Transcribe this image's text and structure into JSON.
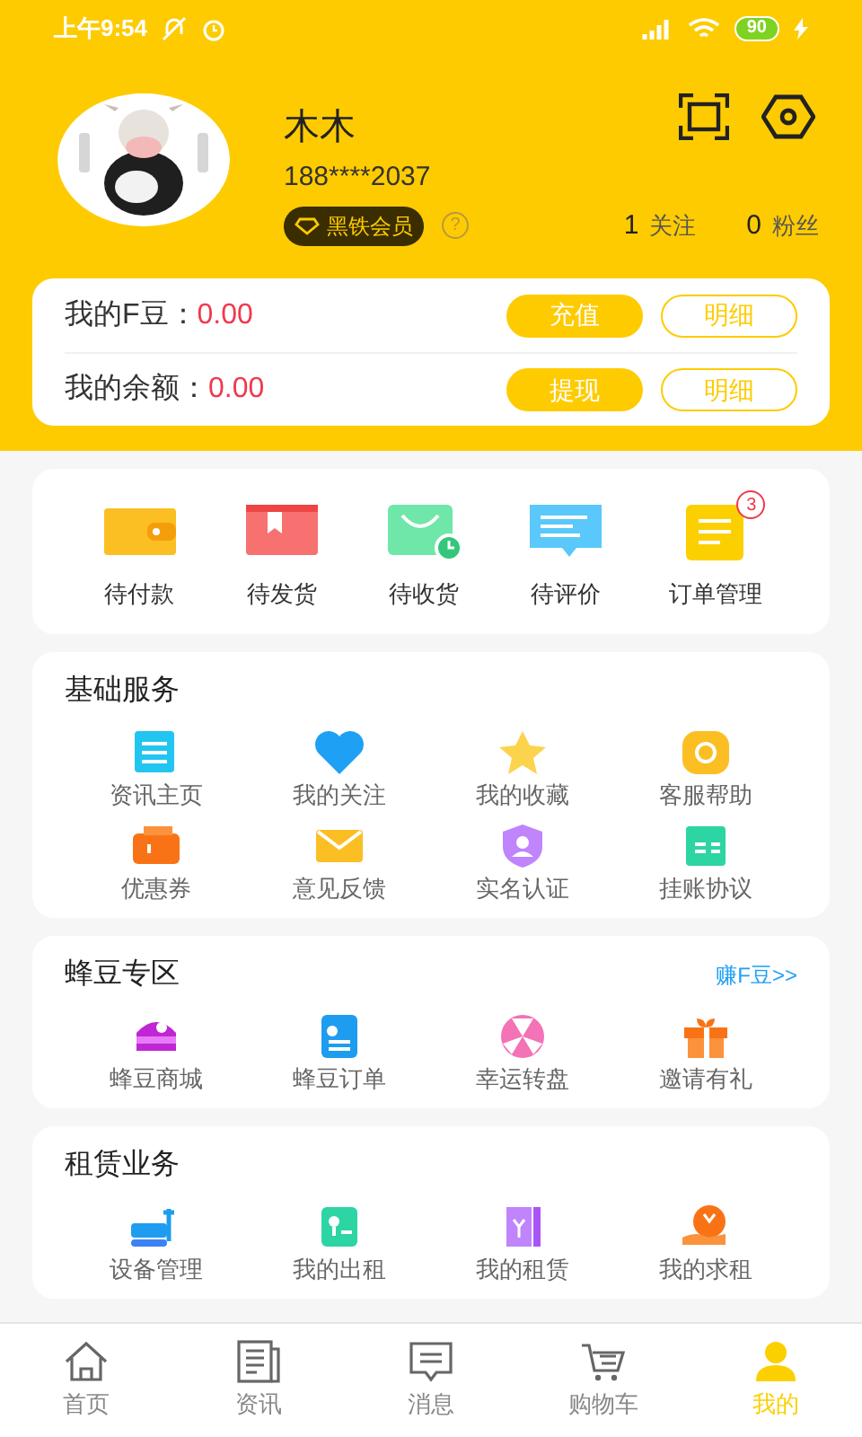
{
  "status_bar": {
    "time": "上午9:54",
    "battery": "90"
  },
  "profile": {
    "name": "木木",
    "phone": "188****2037",
    "badge": "黑铁会员",
    "help": "?",
    "stats": [
      {
        "value": "1",
        "label": "关注"
      },
      {
        "value": "0",
        "label": "粉丝"
      }
    ]
  },
  "wallet": [
    {
      "label": "我的F豆：",
      "amount": "0.00",
      "action": "充值",
      "detail": "明细"
    },
    {
      "label": "我的余额：",
      "amount": "0.00",
      "action": "提现",
      "detail": "明细"
    }
  ],
  "orders": [
    {
      "label": "待付款"
    },
    {
      "label": "待发货"
    },
    {
      "label": "待收货"
    },
    {
      "label": "待评价"
    },
    {
      "label": "订单管理",
      "count": "3"
    }
  ],
  "sections": [
    {
      "title": "基础服务",
      "items": [
        "资讯主页",
        "我的关注",
        "我的收藏",
        "客服帮助",
        "优惠券",
        "意见反馈",
        "实名认证",
        "挂账协议"
      ]
    },
    {
      "title": "蜂豆专区",
      "link": "赚F豆>>",
      "items": [
        "蜂豆商城",
        "蜂豆订单",
        "幸运转盘",
        "邀请有礼"
      ]
    },
    {
      "title": "租赁业务",
      "items": [
        "设备管理",
        "我的出租",
        "我的租赁",
        "我的求租"
      ]
    }
  ],
  "nav": [
    {
      "label": "首页",
      "selected": false
    },
    {
      "label": "资讯",
      "selected": false
    },
    {
      "label": "消息",
      "selected": false
    },
    {
      "label": "购物车",
      "selected": false
    },
    {
      "label": "我的",
      "selected": true
    }
  ]
}
